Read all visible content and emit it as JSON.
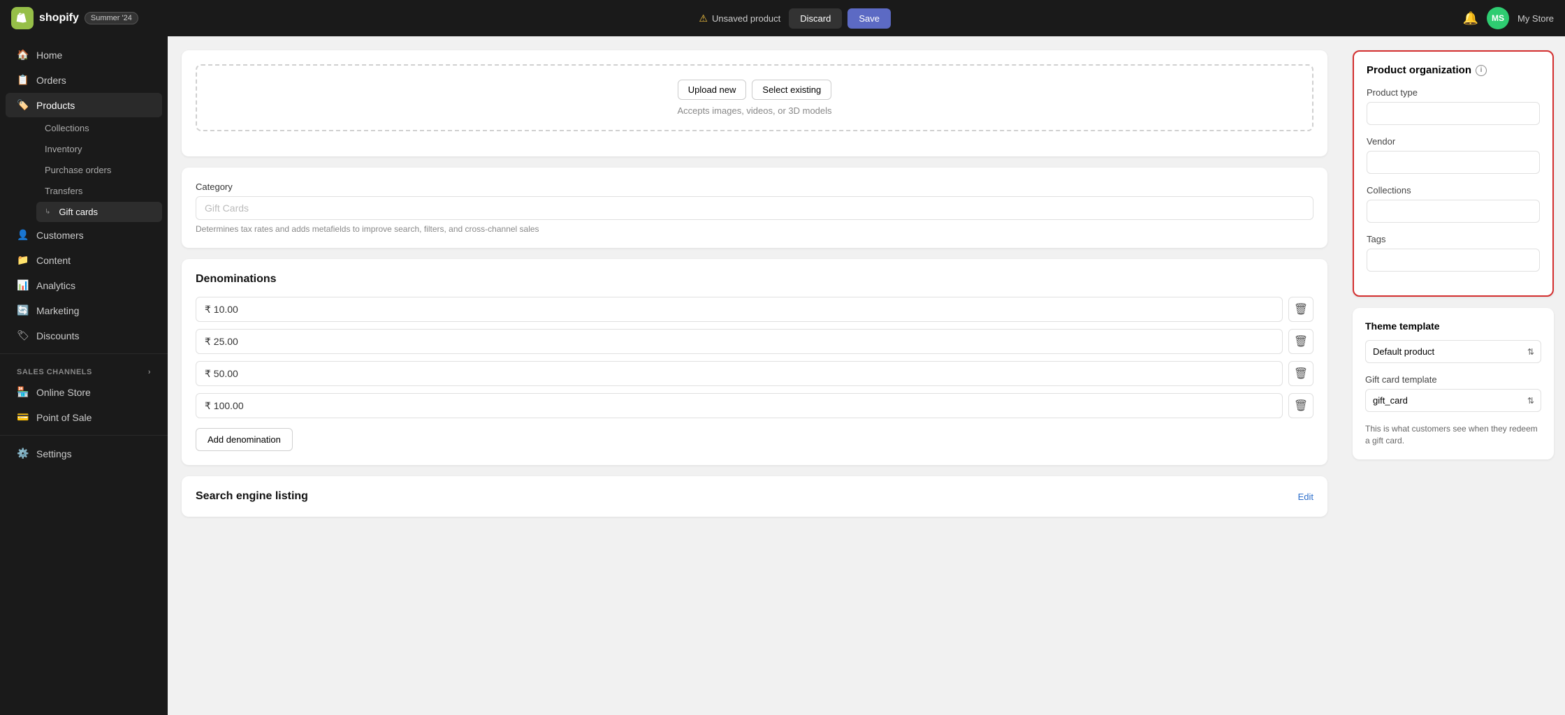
{
  "topbar": {
    "logo_text": "shopify",
    "badge": "Summer '24",
    "unsaved_notice": "Unsaved product",
    "discard_label": "Discard",
    "save_label": "Save",
    "store_name": "My Store",
    "avatar_initials": "MS"
  },
  "sidebar": {
    "nav_items": [
      {
        "id": "home",
        "label": "Home",
        "icon": "🏠"
      },
      {
        "id": "orders",
        "label": "Orders",
        "icon": "📋"
      },
      {
        "id": "products",
        "label": "Products",
        "icon": "🏷️",
        "active": true
      }
    ],
    "products_sub": [
      {
        "id": "collections",
        "label": "Collections"
      },
      {
        "id": "inventory",
        "label": "Inventory"
      },
      {
        "id": "purchase-orders",
        "label": "Purchase orders"
      },
      {
        "id": "transfers",
        "label": "Transfers"
      },
      {
        "id": "gift-cards",
        "label": "Gift cards",
        "active": true
      }
    ],
    "more_nav": [
      {
        "id": "customers",
        "label": "Customers",
        "icon": "👤"
      },
      {
        "id": "content",
        "label": "Content",
        "icon": "📁"
      },
      {
        "id": "analytics",
        "label": "Analytics",
        "icon": "📊"
      },
      {
        "id": "marketing",
        "label": "Marketing",
        "icon": "🔄"
      },
      {
        "id": "discounts",
        "label": "Discounts",
        "icon": "🏷"
      }
    ],
    "sales_channels_label": "Sales channels",
    "sales_channels": [
      {
        "id": "online-store",
        "label": "Online Store",
        "icon": "🏪"
      },
      {
        "id": "point-of-sale",
        "label": "Point of Sale",
        "icon": "💳"
      }
    ],
    "settings": {
      "label": "Settings",
      "icon": "⚙️"
    }
  },
  "main": {
    "upload": {
      "upload_new_label": "Upload new",
      "select_existing_label": "Select existing",
      "hint": "Accepts images, videos, or 3D models"
    },
    "category": {
      "label": "Category",
      "placeholder": "Gift Cards",
      "hint": "Determines tax rates and adds metafields to improve search, filters, and cross-channel sales"
    },
    "denominations": {
      "title": "Denominations",
      "items": [
        {
          "value": "₹ 10.00"
        },
        {
          "value": "₹ 25.00"
        },
        {
          "value": "₹ 50.00"
        },
        {
          "value": "₹ 100.00"
        }
      ],
      "add_label": "Add denomination"
    },
    "seo": {
      "title": "Search engine listing",
      "edit_label": "Edit"
    }
  },
  "right_panel": {
    "organization": {
      "title": "Product organization",
      "info_icon": "i",
      "product_type_label": "Product type",
      "vendor_label": "Vendor",
      "collections_label": "Collections",
      "tags_label": "Tags"
    },
    "template": {
      "title": "Theme template",
      "options": [
        "Default product"
      ],
      "selected": "Default product",
      "gift_card_template_label": "Gift card template",
      "gift_card_options": [
        "gift_card"
      ],
      "gift_card_selected": "gift_card",
      "hint": "This is what customers see when they redeem a gift card."
    }
  }
}
